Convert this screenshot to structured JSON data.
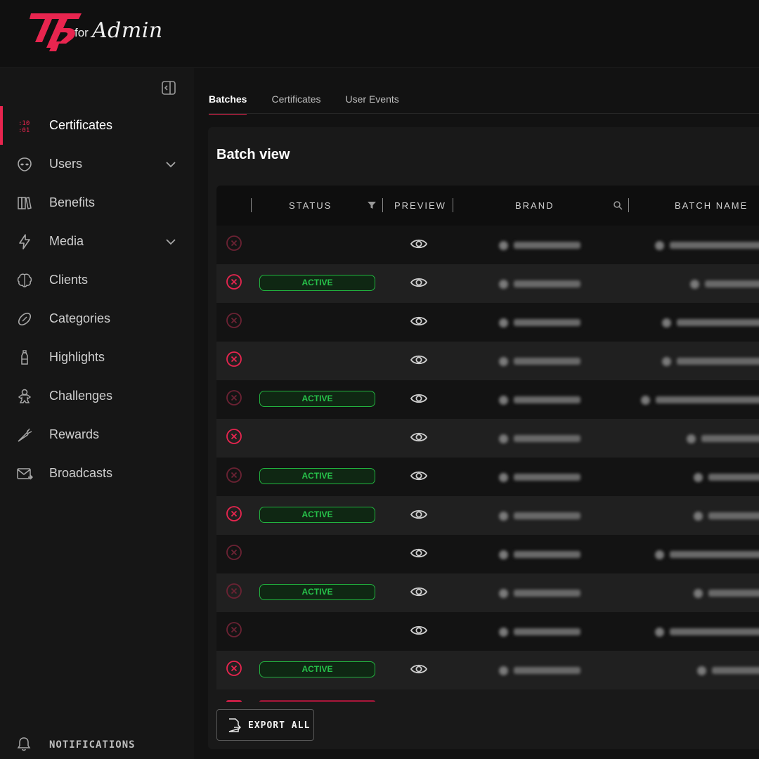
{
  "brand": {
    "logo_icon": "tp-logo-icon",
    "for": "for",
    "admin": "Admin",
    "accent": "#e8254f"
  },
  "sidebar": {
    "collapse_icon": "sidebar-collapse-icon",
    "items": [
      {
        "label": "Certificates",
        "icon": "binary-icon",
        "active": true,
        "expandable": false
      },
      {
        "label": "Users",
        "icon": "alien-face-icon",
        "active": false,
        "expandable": true
      },
      {
        "label": "Benefits",
        "icon": "books-icon",
        "active": false,
        "expandable": false
      },
      {
        "label": "Media",
        "icon": "lightning-icon",
        "active": false,
        "expandable": true
      },
      {
        "label": "Clients",
        "icon": "brain-icon",
        "active": false,
        "expandable": false
      },
      {
        "label": "Categories",
        "icon": "football-icon",
        "active": false,
        "expandable": false
      },
      {
        "label": "Highlights",
        "icon": "bottle-icon",
        "active": false,
        "expandable": false
      },
      {
        "label": "Challenges",
        "icon": "gingerbread-icon",
        "active": false,
        "expandable": false
      },
      {
        "label": "Rewards",
        "icon": "carrot-icon",
        "active": false,
        "expandable": false
      },
      {
        "label": "Broadcasts",
        "icon": "mail-icon",
        "active": false,
        "expandable": false
      }
    ],
    "notifications_label": "NOTIFICATIONS"
  },
  "tabs": [
    {
      "label": "Batches",
      "active": true
    },
    {
      "label": "Certificates",
      "active": false
    },
    {
      "label": "User Events",
      "active": false
    }
  ],
  "card": {
    "title": "Batch view"
  },
  "table": {
    "columns": {
      "status": "STATUS",
      "preview": "PREVIEW",
      "brand": "BRAND",
      "batch_name": "BATCH NAME"
    },
    "rows": [
      {
        "delete_bright": false,
        "status": ""
      },
      {
        "delete_bright": true,
        "status": "ACTIVE"
      },
      {
        "delete_bright": false,
        "status": ""
      },
      {
        "delete_bright": true,
        "status": ""
      },
      {
        "delete_bright": false,
        "status": "ACTIVE"
      },
      {
        "delete_bright": true,
        "status": ""
      },
      {
        "delete_bright": false,
        "status": "ACTIVE"
      },
      {
        "delete_bright": true,
        "status": "ACTIVE"
      },
      {
        "delete_bright": false,
        "status": ""
      },
      {
        "delete_bright": false,
        "status": "ACTIVE"
      },
      {
        "delete_bright": false,
        "status": ""
      },
      {
        "delete_bright": true,
        "status": "ACTIVE"
      }
    ]
  },
  "export": {
    "label": "EXPORT ALL",
    "icon": "export-file-icon"
  },
  "colors": {
    "active_green": "#27c24a",
    "delete_red": "#e8254f",
    "delete_dim": "#6b2233"
  }
}
